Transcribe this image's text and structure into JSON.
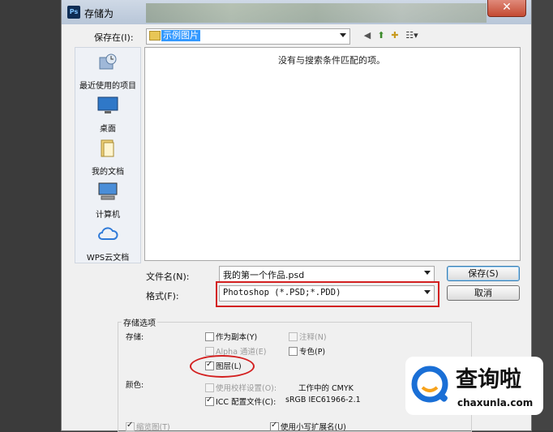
{
  "window": {
    "title": "存储为",
    "app_badge": "Ps",
    "close_glyph": "✕"
  },
  "save_in": {
    "label": "保存在(I):",
    "value": "示例图片"
  },
  "toolbar": {
    "back": "◀",
    "up": "⬆",
    "newfolder": "✚",
    "view": "☷▾"
  },
  "places": [
    {
      "label": "最近使用的项目",
      "icon": "recent-items-icon"
    },
    {
      "label": "桌面",
      "icon": "desktop-icon"
    },
    {
      "label": "我的文档",
      "icon": "documents-icon"
    },
    {
      "label": "计算机",
      "icon": "computer-icon"
    },
    {
      "label": "WPS云文档",
      "icon": "cloud-icon"
    }
  ],
  "file_list": {
    "empty_message": "没有与搜索条件匹配的项。"
  },
  "filename": {
    "label": "文件名(N):",
    "value": "我的第一个作品.psd"
  },
  "format": {
    "label": "格式(F):",
    "value": "Photoshop (*.PSD;*.PDD)"
  },
  "buttons": {
    "save": "保存(S)",
    "cancel": "取消"
  },
  "options": {
    "group_title": "存储选项",
    "storage_label": "存储:",
    "as_copy": "作为副本(Y)",
    "notes": "注释(N)",
    "alpha": "Alpha 通道(E)",
    "spot": "专色(P)",
    "layers": "图层(L)",
    "color_label": "颜色:",
    "proof": "使用校样设置(O):",
    "proof_value": "工作中的 CMYK",
    "icc": "ICC 配置文件(C):",
    "icc_value": "sRGB IEC61966-2.1",
    "thumbnail": "缩览图(T)",
    "lowercase_ext": "使用小写扩展名(U)"
  },
  "watermark": {
    "brand": "查询啦",
    "domain": "chaxunla.com"
  },
  "colors": {
    "annotation_red": "#d32020",
    "selection_blue": "#3399ff",
    "watermark_blue": "#1a6fd6"
  }
}
